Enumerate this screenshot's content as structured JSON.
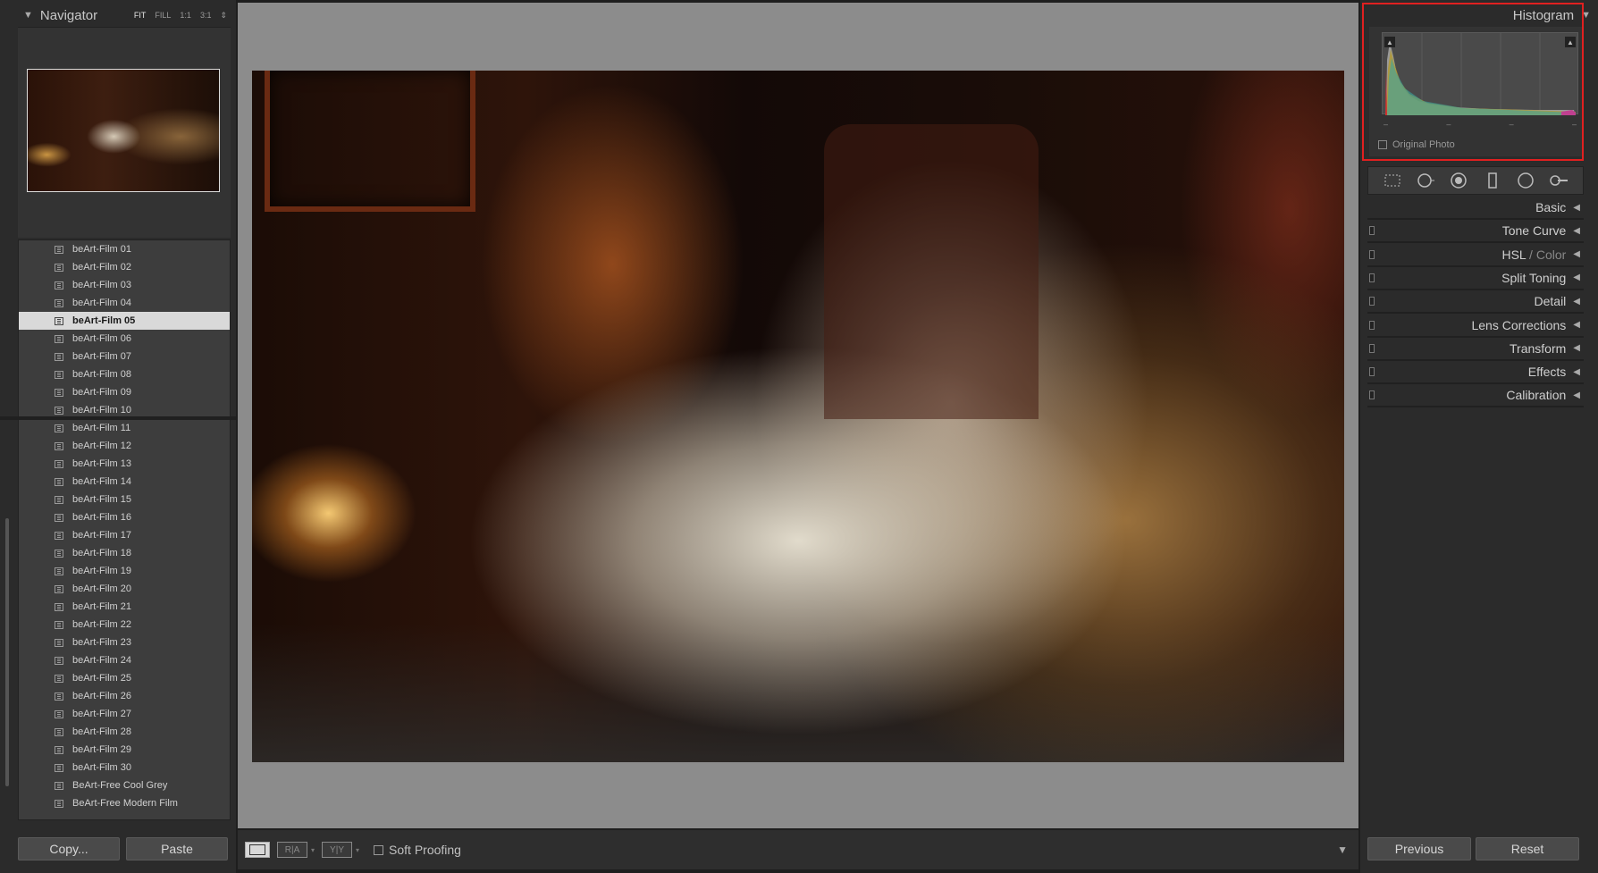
{
  "navigator": {
    "title": "Navigator",
    "zoom_options": [
      "FIT",
      "FILL",
      "1:1",
      "3:1"
    ],
    "zoom_active": "FIT"
  },
  "presets": [
    "beArt-Film 01",
    "beArt-Film 02",
    "beArt-Film 03",
    "beArt-Film 04",
    "beArt-Film 05",
    "beArt-Film 06",
    "beArt-Film 07",
    "beArt-Film 08",
    "beArt-Film 09",
    "beArt-Film 10",
    "beArt-Film 11",
    "beArt-Film 12",
    "beArt-Film 13",
    "beArt-Film 14",
    "beArt-Film 15",
    "beArt-Film 16",
    "beArt-Film 17",
    "beArt-Film 18",
    "beArt-Film 19",
    "beArt-Film 20",
    "beArt-Film 21",
    "beArt-Film 22",
    "beArt-Film 23",
    "beArt-Film 24",
    "beArt-Film 25",
    "beArt-Film 26",
    "beArt-Film 27",
    "beArt-Film 28",
    "beArt-Film 29",
    "beArt-Film 30",
    "BeArt-Free Cool Grey",
    "BeArt-Free Modern Film"
  ],
  "selected_preset": "beArt-Film 05",
  "left_buttons": {
    "copy": "Copy...",
    "paste": "Paste"
  },
  "toolbar": {
    "view_ra": "R|A",
    "view_yy": "Y|Y",
    "soft_proofing": "Soft Proofing"
  },
  "histogram": {
    "title": "Histogram",
    "ticks": [
      "–",
      "–",
      "–",
      "–"
    ],
    "original_photo": "Original Photo"
  },
  "panels": [
    {
      "id": "basic",
      "label": "Basic",
      "dim": ""
    },
    {
      "id": "tone-curve",
      "label": "Tone Curve",
      "dim": ""
    },
    {
      "id": "hsl",
      "label": "HSL",
      "dim": " / Color"
    },
    {
      "id": "split-toning",
      "label": "Split Toning",
      "dim": ""
    },
    {
      "id": "detail",
      "label": "Detail",
      "dim": ""
    },
    {
      "id": "lens-corrections",
      "label": "Lens Corrections",
      "dim": ""
    },
    {
      "id": "transform",
      "label": "Transform",
      "dim": ""
    },
    {
      "id": "effects",
      "label": "Effects",
      "dim": ""
    },
    {
      "id": "calibration",
      "label": "Calibration",
      "dim": ""
    }
  ],
  "right_buttons": {
    "previous": "Previous",
    "reset": "Reset"
  },
  "colors": {
    "highlight": "#e02020",
    "selected_row": "#d9d9d9",
    "canvas": "#8c8c8c"
  },
  "icons": [
    "crop-overlay-icon",
    "spot-removal-icon",
    "red-eye-icon",
    "graduated-filter-icon",
    "radial-filter-icon",
    "adjustment-brush-icon"
  ]
}
